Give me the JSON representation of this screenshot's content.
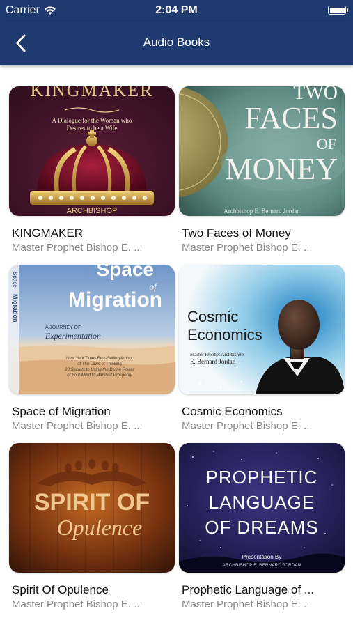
{
  "status_bar": {
    "carrier": "Carrier",
    "time": "2:04 PM",
    "icons": {
      "wifi": "wifi-icon",
      "battery": "battery-icon"
    }
  },
  "navbar": {
    "title": "Audio Books",
    "back_icon": "chevron-left-icon",
    "background": "#1e3a6e"
  },
  "books": [
    {
      "title": "KINGMAKER",
      "author": "Master Prophet Bishop E. ...",
      "cover": {
        "headline": "KINGMAKER",
        "subtitle_line1": "A Dialogue for the Woman who",
        "subtitle_line2": "Desires to be a Wife",
        "footer": "ARCHBISHOP"
      }
    },
    {
      "title": "Two Faces of Money",
      "author": "Master Prophet Bishop E. ...",
      "cover": {
        "line1": "TWO",
        "line2": "FACES",
        "line3": "OF",
        "line4": "MONEY",
        "footer": "Archbishop E. Bernard Jordan"
      }
    },
    {
      "title": "Space of Migration",
      "author": "Master Prophet Bishop E. ...",
      "cover": {
        "line1": "Space",
        "line2": "of",
        "line3": "Migration",
        "tag1": "A JOURNEY OF",
        "tag2": "Experimentation",
        "blurb1": "New York Times Best-Selling Author",
        "blurb2": "of The Laws of Thinking",
        "blurb3": "20 Secrets to Using the Divine Power",
        "blurb4": "of Your Mind to Manifest Prosperity",
        "spine1": "Space",
        "spine2": "Migration"
      }
    },
    {
      "title": "Cosmic Economics",
      "author": "Master Prophet Bishop E. ...",
      "cover": {
        "line1": "Cosmic",
        "line2": "Economics",
        "byline1": "Master Prophet Archbishop",
        "byline2": "E. Bernard Jordan"
      }
    },
    {
      "title": "Spirit Of Opulence",
      "author": "Master Prophet Bishop E. ...",
      "cover": {
        "line1": "SPIRIT OF",
        "line2": "Opulence"
      }
    },
    {
      "title": "Prophetic Language of ...",
      "author": "Master Prophet Bishop E. ...",
      "cover": {
        "line1": "PROPHETIC",
        "line2": "LANGUAGE",
        "line3": "OF DREAMS",
        "byline1": "Presentation By",
        "byline2": "ARCHBISHOP E. BERNARD JORDAN"
      }
    }
  ]
}
